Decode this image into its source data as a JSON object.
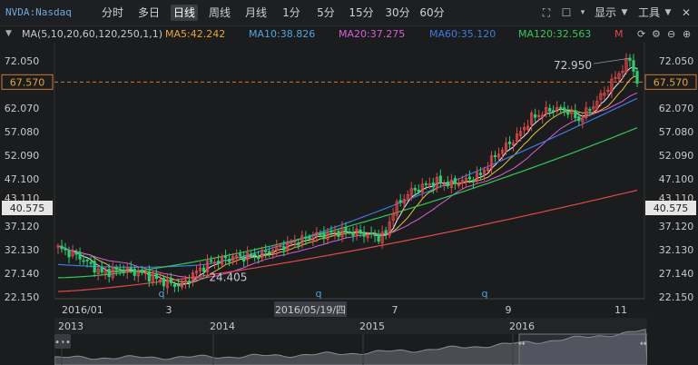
{
  "toolbar": {
    "symbol": "NVDA:Nasdaq",
    "periods": [
      "分时",
      "多日",
      "日线",
      "周线",
      "月线",
      "1分",
      "5分",
      "15分",
      "30分",
      "60分"
    ],
    "active_period": "日线",
    "display_label": "显示",
    "tools_label": "工具"
  },
  "ma_bar": {
    "label": "MA(5,10,20,60,120,250,1,1)",
    "items": [
      {
        "text": "MA5:42.242",
        "color": "#e8a33a"
      },
      {
        "text": "MA10:38.826",
        "color": "#4ea6e0"
      },
      {
        "text": "MA20:37.275",
        "color": "#d65fd6"
      },
      {
        "text": "MA60:35.120",
        "color": "#3d7be0"
      },
      {
        "text": "MA120:32.563",
        "color": "#34c759"
      },
      {
        "text": "M",
        "color": "#e04a4a"
      }
    ]
  },
  "chart_data": {
    "type": "candlestick",
    "y_ticks": [
      "72.050",
      "67.570",
      "62.070",
      "57.080",
      "52.090",
      "47.100",
      "43.110",
      "40.575",
      "37.120",
      "32.130",
      "27.140",
      "22.150"
    ],
    "x_labels": [
      "2016/01",
      "3",
      "2016/05/19/四",
      "7",
      "9",
      "11"
    ],
    "markers": [
      "q",
      "q",
      "q"
    ],
    "crosshair_price": "67.570",
    "cursor_price": "40.575",
    "high_annotation": "72.950",
    "low_annotation": "24.405",
    "ylim": [
      22.15,
      75.0
    ],
    "series": [
      {
        "name": "MA5",
        "color": "#f0f0f0"
      },
      {
        "name": "MA10",
        "color": "#e8c23a"
      },
      {
        "name": "MA20",
        "color": "#d65fd6"
      },
      {
        "name": "MA60",
        "color": "#3d7be0"
      },
      {
        "name": "MA120",
        "color": "#34c759"
      },
      {
        "name": "MA250",
        "color": "#e04a4a"
      }
    ]
  },
  "navigator": {
    "years": [
      "2013",
      "2014",
      "2015",
      "2016"
    ]
  }
}
